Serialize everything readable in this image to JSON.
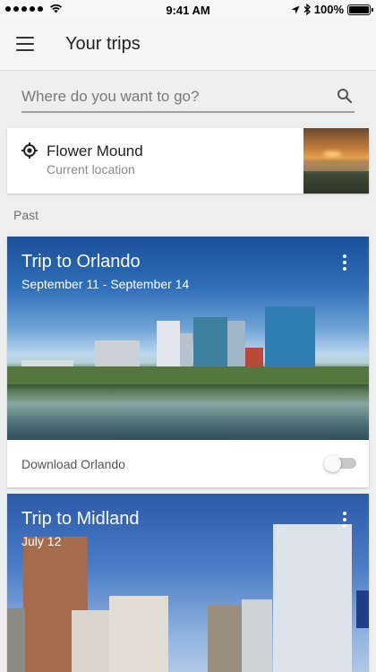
{
  "status_bar": {
    "time": "9:41 AM",
    "battery": "100%",
    "signal_icon": "signal-dots-icon",
    "wifi_icon": "wifi-icon",
    "location_icon": "location-arrow-icon",
    "bluetooth_icon": "bluetooth-icon"
  },
  "app_bar": {
    "title": "Your trips",
    "menu_icon": "hamburger-menu-icon"
  },
  "search": {
    "placeholder": "Where do you want to go?",
    "value": "",
    "icon": "search-icon"
  },
  "current_location": {
    "name": "Flower Mound",
    "subtitle": "Current location",
    "icon": "target-icon"
  },
  "sections": {
    "past_label": "Past"
  },
  "trips": [
    {
      "title": "Trip to Orlando",
      "dates": "September 11 - September 14",
      "download_label": "Download Orlando",
      "download_enabled": false
    },
    {
      "title": "Trip to Midland",
      "dates": "July 12"
    }
  ],
  "colors": {
    "background": "#eeeeee",
    "app_bar": "#f5f5f5",
    "card": "#ffffff",
    "toggle_off": "#c8c8c8"
  }
}
